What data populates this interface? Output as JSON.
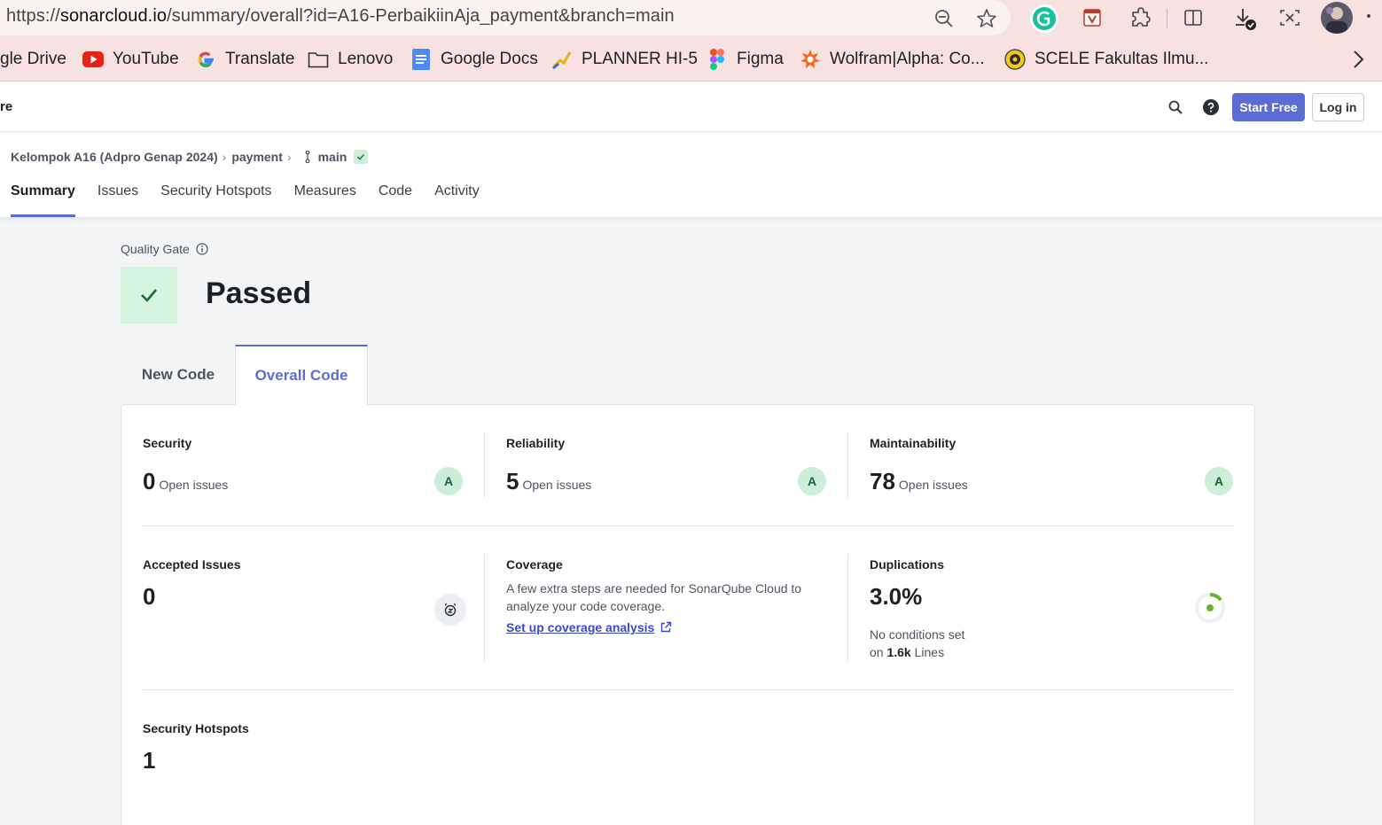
{
  "browser": {
    "url_prefix": "https://",
    "url_host": "sonarcloud.io",
    "url_path": "/summary/overall?id=A16-PerbaikiinAja_payment&branch=main",
    "bookmarks": [
      {
        "label": "gle Drive",
        "icon": "drive-icon"
      },
      {
        "label": "YouTube",
        "icon": "youtube-icon"
      },
      {
        "label": "Translate",
        "icon": "google-icon"
      },
      {
        "label": "Lenovo",
        "icon": "folder-icon"
      },
      {
        "label": "Google Docs",
        "icon": "docs-icon"
      },
      {
        "label": "PLANNER HI-5",
        "icon": "planner-icon"
      },
      {
        "label": "Figma",
        "icon": "figma-icon"
      },
      {
        "label": "Wolfram|Alpha: Co...",
        "icon": "wolfram-icon"
      },
      {
        "label": "SCELE Fakultas Ilmu...",
        "icon": "scele-icon"
      }
    ]
  },
  "header": {
    "brand_fragment": "re",
    "start_free": "Start Free",
    "login": "Log in"
  },
  "breadcrumb": {
    "organization": "Kelompok A16 (Adpro Genap 2024)",
    "project": "payment",
    "branch": "main"
  },
  "tabs": [
    "Summary",
    "Issues",
    "Security Hotspots",
    "Measures",
    "Code",
    "Activity"
  ],
  "quality_gate": {
    "label": "Quality Gate",
    "status": "Passed"
  },
  "code_tabs": {
    "new_code": "New Code",
    "overall_code": "Overall Code"
  },
  "metrics": {
    "security": {
      "title": "Security",
      "value": "0",
      "sub": "Open issues",
      "grade": "A"
    },
    "reliability": {
      "title": "Reliability",
      "value": "5",
      "sub": "Open issues",
      "grade": "A"
    },
    "maintainability": {
      "title": "Maintainability",
      "value": "78",
      "sub": "Open issues",
      "grade": "A"
    },
    "accepted": {
      "title": "Accepted Issues",
      "value": "0"
    },
    "coverage": {
      "title": "Coverage",
      "desc_line1": "A few extra steps are needed for SonarQube Cloud to",
      "desc_line2": "analyze your code coverage.",
      "link": "Set up coverage analysis"
    },
    "duplications": {
      "title": "Duplications",
      "value": "3.0%",
      "note_line1": "No conditions set",
      "note_prefix": "on",
      "note_lines": "1.6k",
      "note_suffix": "Lines"
    },
    "hotspots": {
      "title": "Security Hotspots",
      "value": "1"
    }
  },
  "colors": {
    "accent": "#5d6cd3",
    "pass_bg": "#d6f5df",
    "grade_bg": "#cdeed8",
    "duplication_green": "#6bb32e"
  }
}
